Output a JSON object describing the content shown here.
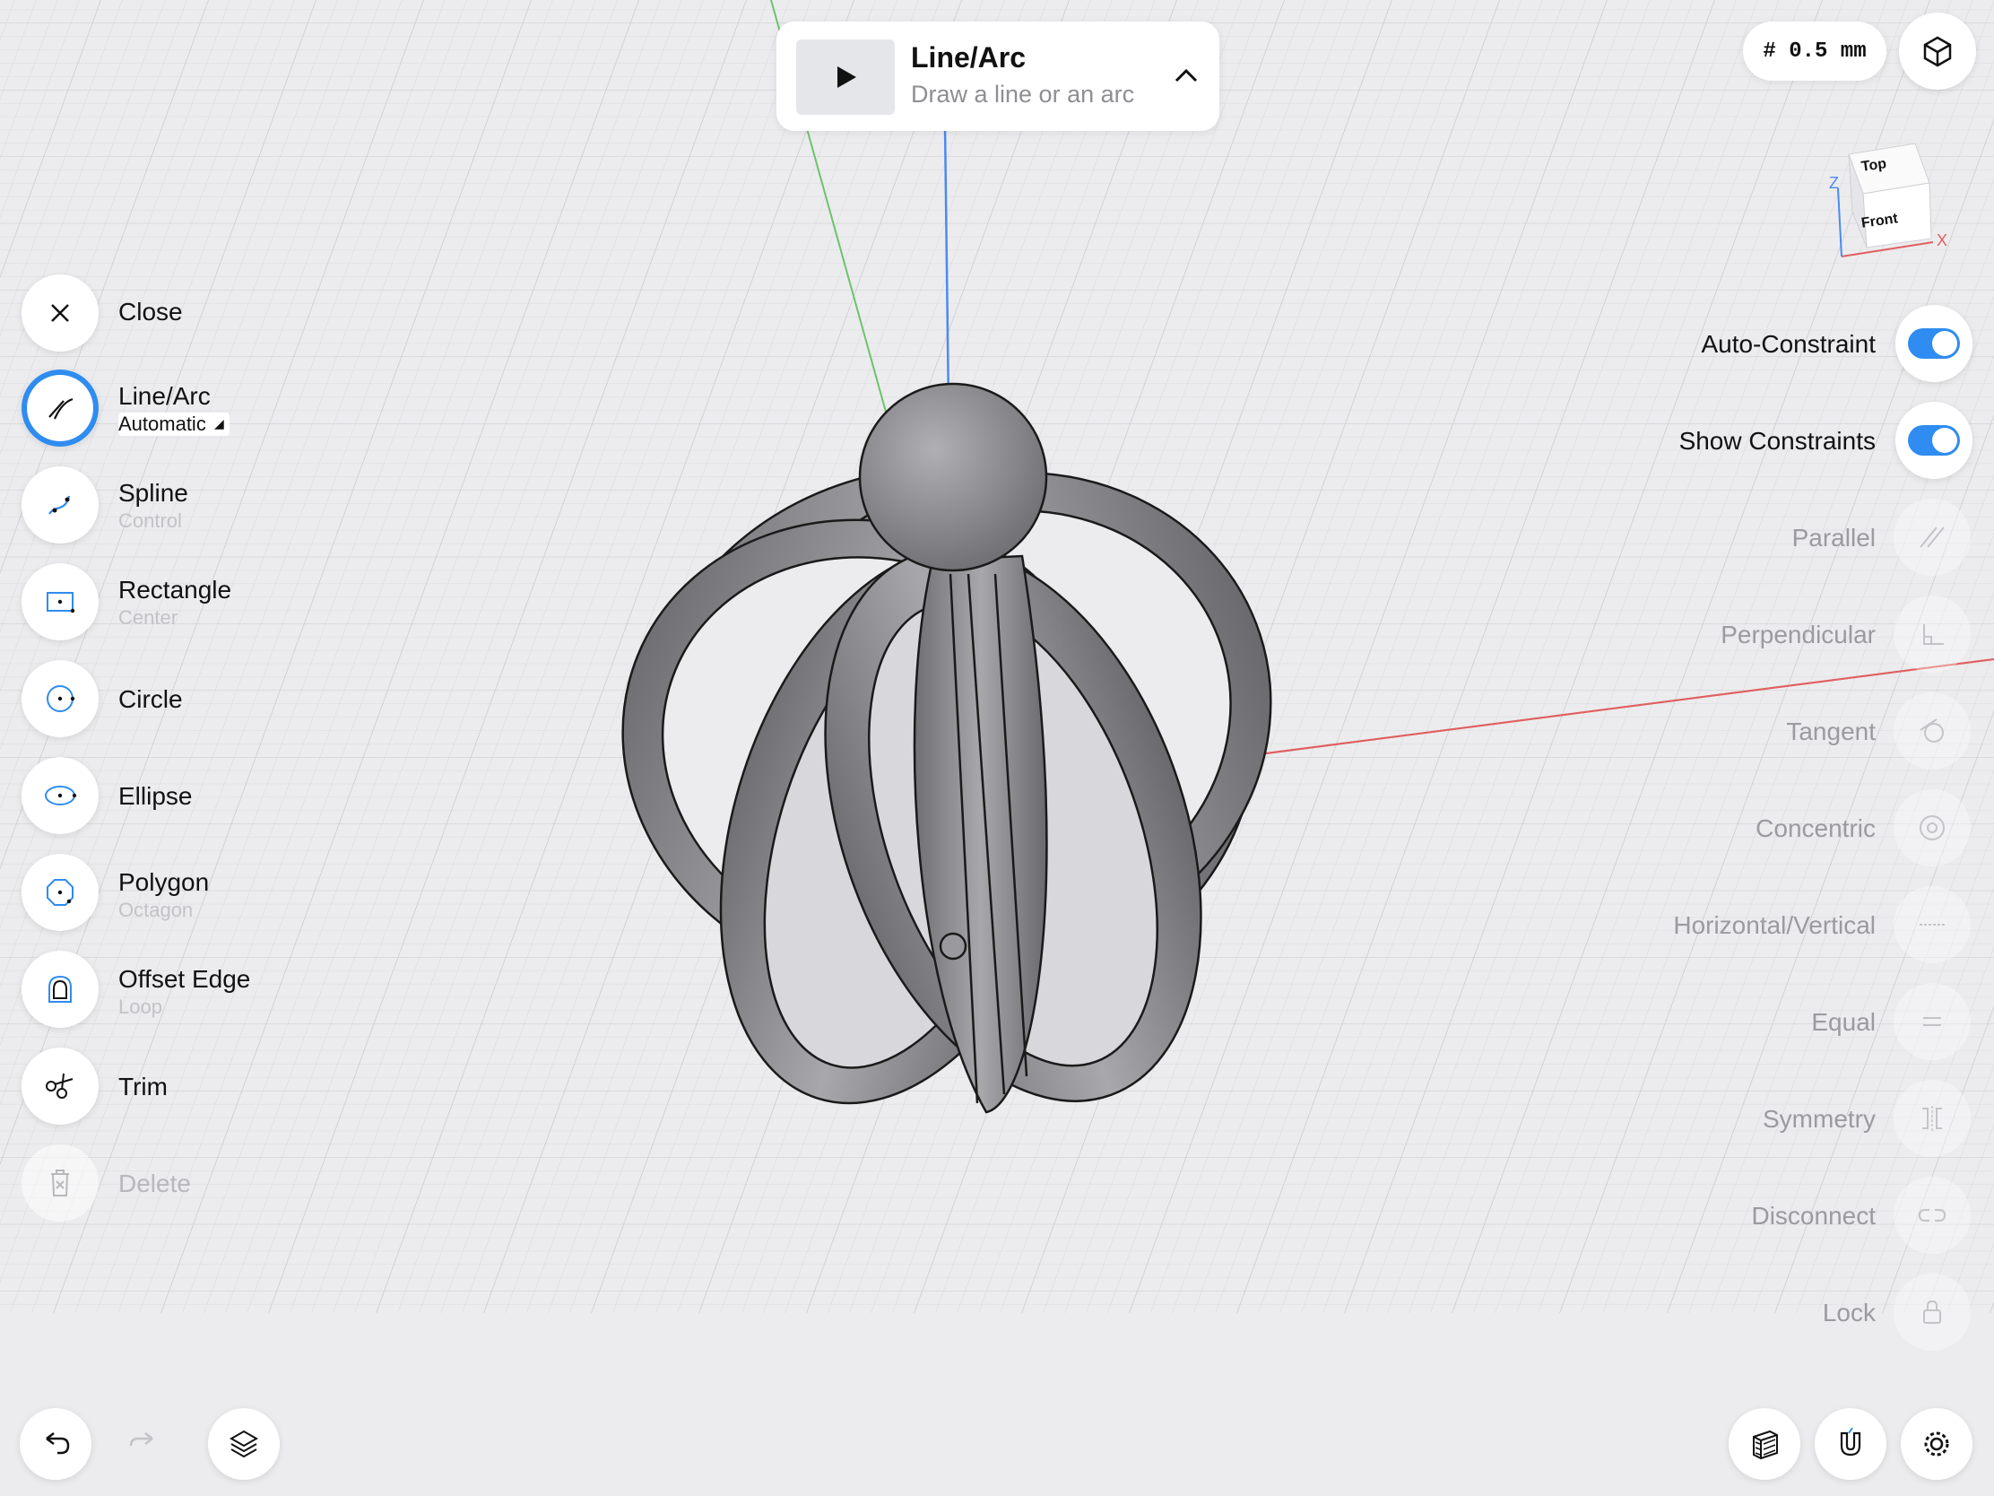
{
  "tool_card": {
    "title": "Line/Arc",
    "subtitle": "Draw a line or an arc",
    "play_icon": "play-icon",
    "expand_icon": "chevron-up-icon"
  },
  "grid_pill": {
    "label": "# 0.5 mm"
  },
  "view_cube": {
    "top": "Top",
    "front": "Front",
    "axis_x": "X",
    "axis_z": "Z"
  },
  "tools": [
    {
      "label": "Close",
      "sub": "",
      "icon": "close-icon"
    },
    {
      "label": "Line/Arc",
      "sub": "Automatic",
      "icon": "line-arc-icon",
      "active": true
    },
    {
      "label": "Spline",
      "sub": "Control",
      "icon": "spline-icon"
    },
    {
      "label": "Rectangle",
      "sub": "Center",
      "icon": "rectangle-icon"
    },
    {
      "label": "Circle",
      "sub": "",
      "icon": "circle-icon"
    },
    {
      "label": "Ellipse",
      "sub": "",
      "icon": "ellipse-icon"
    },
    {
      "label": "Polygon",
      "sub": "Octagon",
      "icon": "polygon-icon"
    },
    {
      "label": "Offset Edge",
      "sub": "Loop",
      "icon": "offset-edge-icon"
    },
    {
      "label": "Trim",
      "sub": "",
      "icon": "trim-icon"
    },
    {
      "label": "Delete",
      "sub": "",
      "icon": "delete-icon",
      "disabled": true
    }
  ],
  "toggles": [
    {
      "label": "Auto-Constraint",
      "on": true
    },
    {
      "label": "Show Constraints",
      "on": true
    }
  ],
  "constraints": [
    {
      "label": "Parallel",
      "icon": "parallel-icon"
    },
    {
      "label": "Perpendicular",
      "icon": "perpendicular-icon"
    },
    {
      "label": "Tangent",
      "icon": "tangent-icon"
    },
    {
      "label": "Concentric",
      "icon": "concentric-icon"
    },
    {
      "label": "Horizontal/Vertical",
      "icon": "horizontal-vertical-icon"
    },
    {
      "label": "Equal",
      "icon": "equal-icon"
    },
    {
      "label": "Symmetry",
      "icon": "symmetry-icon"
    },
    {
      "label": "Disconnect",
      "icon": "disconnect-icon"
    },
    {
      "label": "Lock",
      "icon": "lock-icon"
    }
  ],
  "bottom_left": [
    "undo-icon",
    "redo-icon",
    "layers-icon"
  ],
  "bottom_right": [
    "section-view-icon",
    "snap-magnet-icon",
    "settings-gear-icon"
  ],
  "colors": {
    "accent": "#2f8cf0",
    "axis_y": "#4a8af0",
    "axis_x": "#e06060",
    "axis_green": "#6cc36c",
    "model": "#8e8e92"
  }
}
